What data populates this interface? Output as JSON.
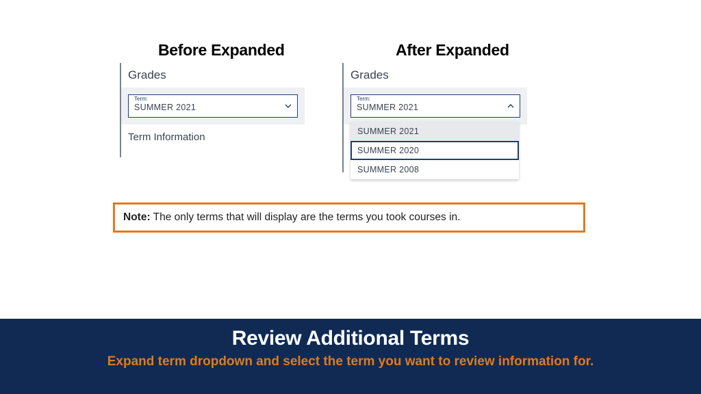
{
  "columns": {
    "before": {
      "title": "Before Expanded"
    },
    "after": {
      "title": "After Expanded"
    }
  },
  "grades": {
    "heading": "Grades",
    "term_label": "Term:",
    "term_selected": "SUMMER 2021",
    "term_info_heading": "Term Information",
    "options": [
      "SUMMER 2021",
      "SUMMER 2020",
      "SUMMER 2008"
    ],
    "highlight_index": 1
  },
  "note": {
    "label": "Note:",
    "text": " The only terms that will display are the terms you took courses in."
  },
  "footer": {
    "title": "Review Additional Terms",
    "subtitle": "Expand term dropdown and select the term you want to review information for."
  }
}
